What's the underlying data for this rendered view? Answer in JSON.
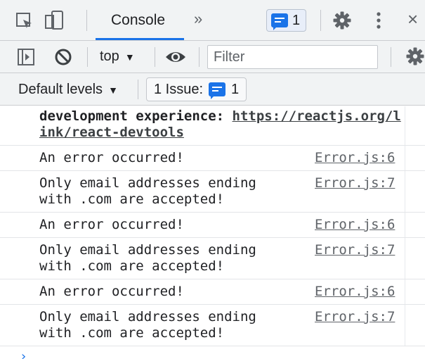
{
  "tabbar": {
    "inspect_icon": "inspect-element-icon",
    "device_icon": "device-toolbar-icon",
    "tab_label": "Console",
    "more_tabs": "»",
    "issues_count": "1",
    "settings_icon": "gear-icon",
    "kebab_icon": "more-vertical-icon",
    "close_label": "×"
  },
  "filterbar": {
    "sidebar_icon": "sidebar-toggle-icon",
    "clear_icon": "clear-console-icon",
    "context_value": "top",
    "eye_icon": "eye-icon",
    "filter_placeholder": "Filter",
    "settings_icon": "gear-icon"
  },
  "levelsbar": {
    "levels_label": "Default levels",
    "issues_label": "1 Issue:",
    "issues_count": "1"
  },
  "console": {
    "dev_prefix": "development experience: ",
    "dev_link": "https://reactjs.org/link/react-devtools",
    "entries": [
      {
        "text": "An error occurred!",
        "source": "Error.js:6"
      },
      {
        "text": "Only email addresses ending with .com are accepted!",
        "source": "Error.js:7"
      },
      {
        "text": "An error occurred!",
        "source": "Error.js:6"
      },
      {
        "text": "Only email addresses ending with .com are accepted!",
        "source": "Error.js:7"
      },
      {
        "text": "An error occurred!",
        "source": "Error.js:6"
      },
      {
        "text": "Only email addresses ending with .com are accepted!",
        "source": "Error.js:7"
      }
    ],
    "prompt": "›"
  },
  "colors": {
    "accent": "#1a73e8",
    "toolbar_bg": "#f1f3f4",
    "source_link": "#5f6368"
  }
}
